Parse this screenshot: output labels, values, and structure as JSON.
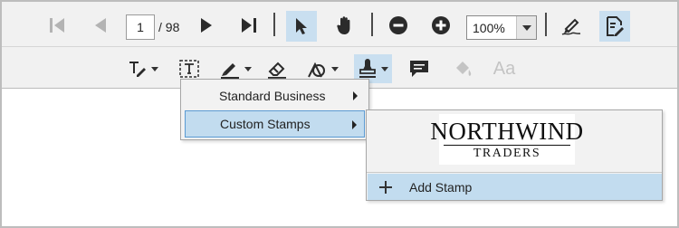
{
  "toolbar": {
    "page_current": "1",
    "page_total": "/ 98",
    "zoom_value": "100%"
  },
  "annotation_toolbar": {
    "font_label": "Aa"
  },
  "stamp_menu": {
    "items": [
      {
        "label": "Standard Business"
      },
      {
        "label": "Custom Stamps"
      }
    ]
  },
  "custom_stamps": {
    "stamp": {
      "line1": "NORTHWIND",
      "line2": "TRADERS"
    },
    "add_label": "Add Stamp"
  }
}
